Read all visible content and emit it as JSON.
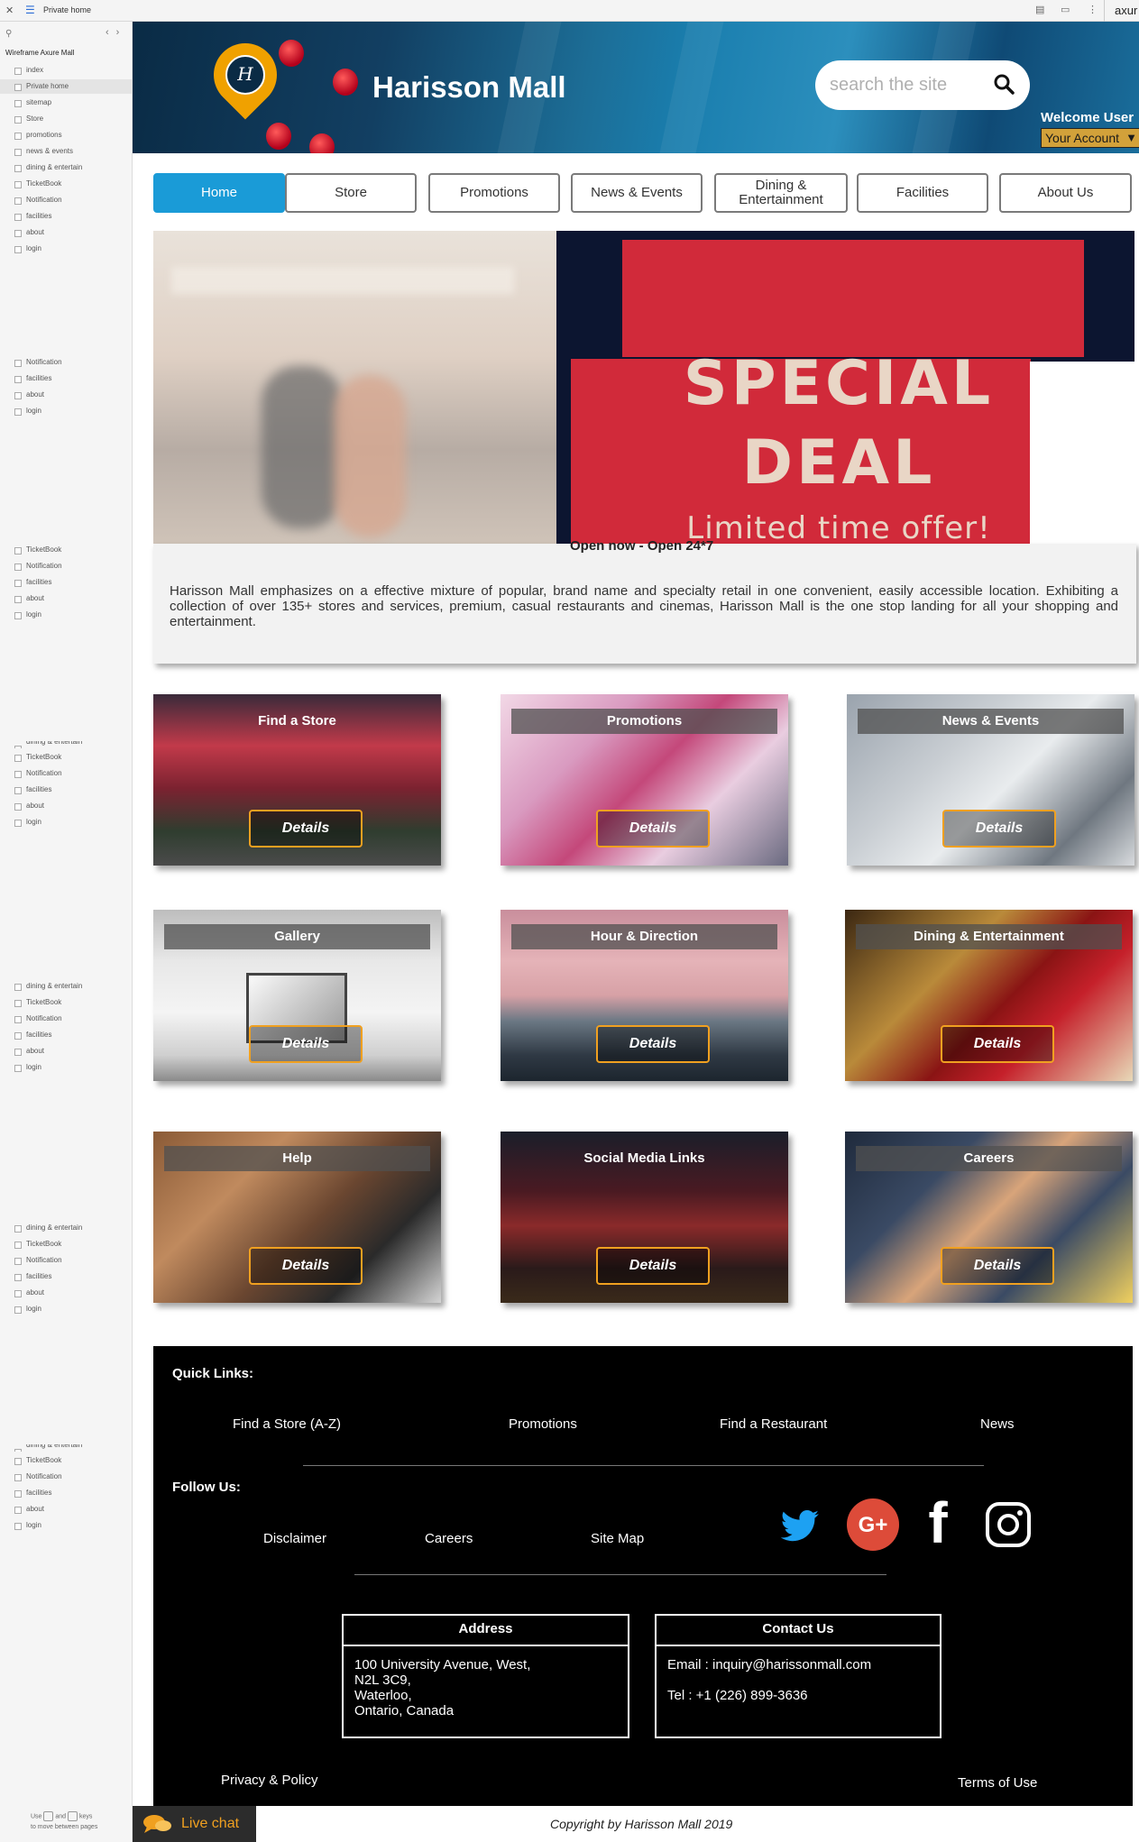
{
  "browser": {
    "title": "Private home",
    "app_name": "axur"
  },
  "sidebar": {
    "project": "Wireframe Axure Mall",
    "items": [
      {
        "label": "index",
        "y": 0
      },
      {
        "label": "Private home",
        "active": true
      },
      {
        "label": "sitemap"
      },
      {
        "label": "Store"
      },
      {
        "label": "promotions"
      },
      {
        "label": "news & events"
      },
      {
        "label": "dining & entertain"
      },
      {
        "label": "TicketBook"
      },
      {
        "label": "Notification"
      },
      {
        "label": "facilities"
      },
      {
        "label": "about"
      },
      {
        "label": "login"
      }
    ],
    "group2": [
      "Notification",
      "facilities",
      "about",
      "login"
    ],
    "group3": [
      "TicketBook",
      "Notification",
      "facilities",
      "about",
      "login"
    ],
    "group4": [
      "dining & entertain",
      "TicketBook",
      "Notification",
      "facilities",
      "about",
      "login"
    ],
    "group5": [
      "dining & entertain",
      "TicketBook",
      "Notification",
      "facilities",
      "about",
      "login"
    ],
    "group6": [
      "dining & entertain",
      "TicketBook",
      "Notification",
      "facilities",
      "about",
      "login"
    ],
    "group7": [
      "dining & entertain",
      "TicketBook",
      "Notification",
      "facilities",
      "about",
      "login"
    ],
    "footer_use": "Use",
    "footer_and": "and",
    "footer_keys": "keys",
    "footer_rest": "to move between pages"
  },
  "header": {
    "logo_letter": "H",
    "title": "Harisson Mall",
    "search_placeholder": "search the site",
    "welcome": "Welcome User",
    "account": "Your Account"
  },
  "nav": [
    {
      "label": "Home",
      "active": true
    },
    {
      "label": "Store"
    },
    {
      "label": "Promotions"
    },
    {
      "label": "News & Events"
    },
    {
      "label": "Dining & Entertainment"
    },
    {
      "label": "Facilities"
    },
    {
      "label": "About Us"
    }
  ],
  "hero": {
    "line1": "SPECIAL",
    "line2": "DEAL",
    "line3": "Limited time offer!"
  },
  "intro": {
    "open": "Open now - Open 24*7",
    "description": "Harisson Mall emphasizes on a effective mixture of popular, brand name and specialty retail in one convenient, easily accessible location. Exhibiting a collection of over 135+ stores and services, premium, casual restaurants and cinemas, Harisson Mall is the one stop landing for all your shopping and entertainment."
  },
  "cards": [
    {
      "label": "Find a Store",
      "details": "Details"
    },
    {
      "label": "Promotions",
      "details": "Details"
    },
    {
      "label": "News & Events",
      "details": "Details"
    },
    {
      "label": "Gallery",
      "details": "Details"
    },
    {
      "label": "Hour & Direction",
      "details": "Details"
    },
    {
      "label": "Dining & Entertainment",
      "details": "Details"
    },
    {
      "label": "Help",
      "details": "Details"
    },
    {
      "label": "Social Media Links",
      "details": "Details"
    },
    {
      "label": "Careers",
      "details": "Details"
    }
  ],
  "footer": {
    "quick_links_heading": "Quick Links:",
    "quick_links": [
      "Find a Store (A-Z)",
      "Promotions",
      "Find a Restaurant",
      "News"
    ],
    "follow_heading": "Follow Us:",
    "follow_links": [
      "Disclaimer",
      "Careers",
      "Site Map"
    ],
    "social": [
      "twitter-icon",
      "google-plus-icon",
      "facebook-icon",
      "instagram-icon"
    ],
    "google_plus_text": "G+",
    "facebook_text": "f",
    "address_heading": "Address",
    "address_lines": [
      "100 University Avenue, West,",
      "N2L 3C9,",
      "Waterloo,",
      "Ontario, Canada"
    ],
    "contact_heading": "Contact Us",
    "contact_email": "Email : inquiry@harissonmall.com",
    "contact_tel": "Tel : +1 (226) 899-3636",
    "privacy": "Privacy & Policy",
    "terms": "Terms of Use"
  },
  "copyright": "Copyright by Harisson Mall  2019",
  "live_chat": "Live chat",
  "colors": {
    "accent_blue": "#1a9bd7",
    "accent_orange": "#f0a020",
    "footer_bg": "#000000"
  }
}
